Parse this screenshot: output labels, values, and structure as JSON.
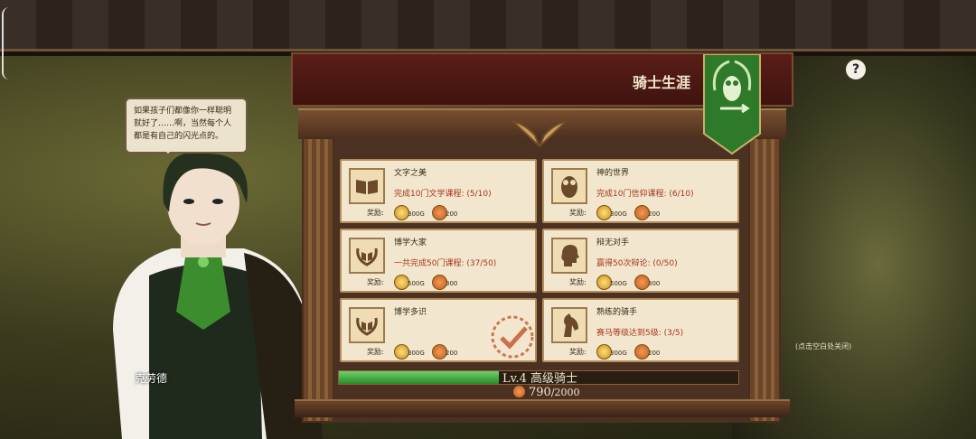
{
  "dialog": {
    "speech": "如果孩子们都像你一样聪明就好了……啊，当然每个人都是有自己的闪光点的。",
    "character_name": "克劳德"
  },
  "panel": {
    "title": "骑士生涯",
    "help": "?",
    "close_hint": "(点击空白处关闭)"
  },
  "achievements": [
    {
      "title": "文字之美",
      "progress": "完成10门文学课程: (5/10)",
      "reward_label": "奖励:",
      "gold": "300G",
      "credit": "200",
      "icon": "book-icon"
    },
    {
      "title": "神的世界",
      "progress": "完成10门信仰课程: (6/10)",
      "reward_label": "奖励:",
      "gold": "300G",
      "credit": "200",
      "icon": "owl-icon"
    },
    {
      "title": "博学大家",
      "progress": "一共完成50门课程: (37/50)",
      "reward_label": "奖励:",
      "gold": "500G",
      "credit": "300",
      "icon": "laurel-book-icon"
    },
    {
      "title": "辩无对手",
      "progress": "赢得50次辩论: (0/50)",
      "reward_label": "奖励:",
      "gold": "500G",
      "credit": "300",
      "icon": "head-profile-icon"
    },
    {
      "title": "博学多识",
      "progress": "",
      "reward_label": "奖励:",
      "gold": "300G",
      "credit": "200",
      "icon": "laurel-book-icon",
      "completed": true
    },
    {
      "title": "熟练的骑手",
      "progress": "赛马等级达到5级: (3/5)",
      "reward_label": "奖励:",
      "gold": "300G",
      "credit": "200",
      "icon": "horse-head-icon"
    }
  ],
  "level": {
    "label": "Lv.4  高级骑士",
    "progress_fraction": 0.4
  },
  "currency": {
    "current": "790",
    "max": "/2000"
  },
  "colors": {
    "banner_green": "#2f7a2a",
    "progress_green": "#4cbf4a",
    "progress_text": "#a8341f"
  }
}
